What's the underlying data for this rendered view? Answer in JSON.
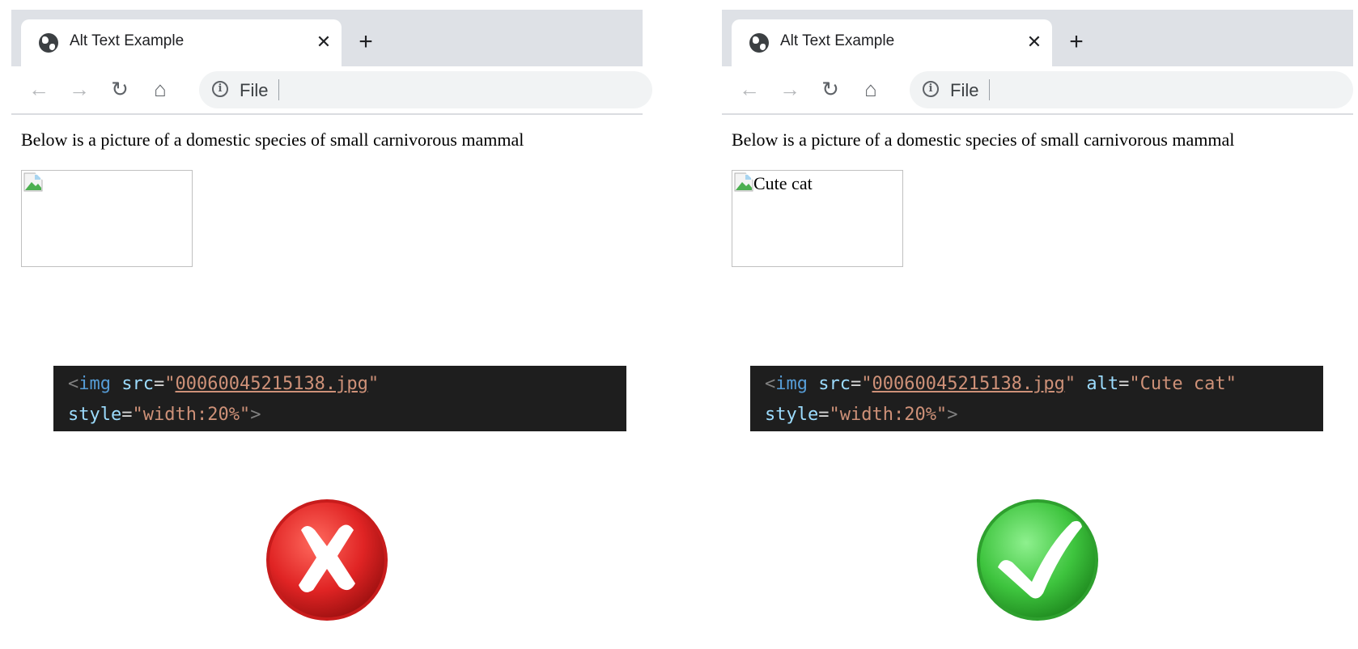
{
  "colors": {
    "tabstrip": "#dee1e6",
    "code_bg": "#1e1e1e",
    "tag": "#569cd6",
    "attr": "#9cdcfe",
    "string": "#ce9178",
    "wrong": "#e02424",
    "right": "#3ec43e"
  },
  "left": {
    "tab": {
      "title": "Alt Text Example",
      "close": "✕",
      "new_tab": "+"
    },
    "toolbar": {
      "back": "←",
      "forward": "→",
      "reload": "↻",
      "home": "⌂",
      "info": "i",
      "address": "File"
    },
    "page_text": "Below is a picture of a domestic species of small carnivorous mammal",
    "image": {
      "alt": ""
    },
    "code": {
      "open": "<",
      "tag": "img",
      "src_attr": "src",
      "eq": "=",
      "quote": "\"",
      "src_value": "00060045215138.jpg",
      "style_attr": "style",
      "style_value": "\"width:20%\"",
      "close": ">"
    },
    "verdict": {
      "icon": "x-mark-icon"
    }
  },
  "right": {
    "tab": {
      "title": "Alt Text Example",
      "close": "✕",
      "new_tab": "+"
    },
    "toolbar": {
      "back": "←",
      "forward": "→",
      "reload": "↻",
      "home": "⌂",
      "info": "i",
      "address": "File"
    },
    "page_text": "Below is a picture of a domestic species of small carnivorous mammal",
    "image": {
      "alt": "Cute cat"
    },
    "code": {
      "open": "<",
      "tag": "img",
      "src_attr": "src",
      "eq": "=",
      "quote": "\"",
      "src_value": "00060045215138.jpg",
      "alt_attr": "alt",
      "alt_value": "\"Cute cat\"",
      "style_attr": "style",
      "style_value": "\"width:20%\"",
      "close": ">"
    },
    "verdict": {
      "icon": "check-mark-icon"
    }
  }
}
